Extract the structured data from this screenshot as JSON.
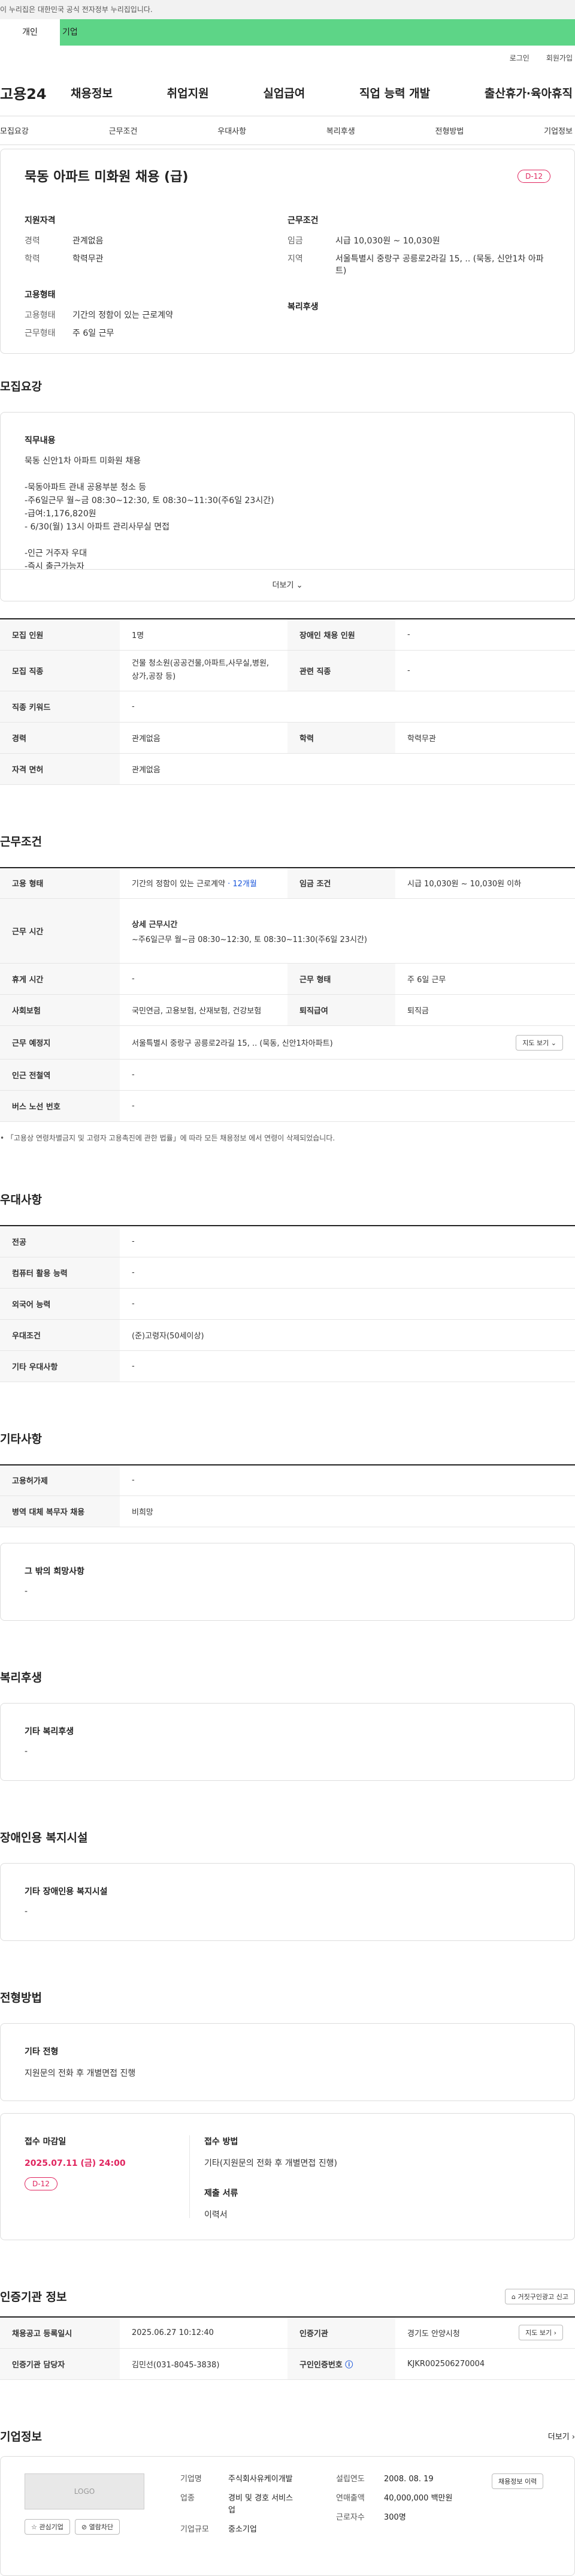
{
  "banner": {
    "text": "이 누리집은 대한민국 공식 전자정부 누리집입니다."
  },
  "user_tabs": [
    "개인",
    "기업"
  ],
  "util": [
    "로그인",
    "회원가입"
  ],
  "logo": "고용24",
  "gnb": [
    "채용정보",
    "취업지원",
    "실업급여",
    "직업 능력 개발",
    "출산휴가·육아휴직"
  ],
  "anchor_tabs": [
    "모집요강",
    "근무조건",
    "우대사항",
    "복리후생",
    "전형방법",
    "기업정보"
  ],
  "summary": {
    "title": "묵동 아파트 미화원 채용 (급)",
    "dday": "D-12",
    "qual_heading": "지원자격",
    "qual": [
      {
        "k": "경력",
        "v": "관계없음"
      },
      {
        "k": "학력",
        "v": "학력무관"
      }
    ],
    "emp_heading": "고용형태",
    "emp": [
      {
        "k": "고용형태",
        "v": "기간의 정함이 있는 근로계약"
      },
      {
        "k": "근무형태",
        "v": "주 6일 근무"
      }
    ],
    "work_heading": "근무조건",
    "work": [
      {
        "k": "임금",
        "v": "시급 10,030원 ~ 10,030원"
      },
      {
        "k": "지역",
        "v": "서울특별시 중랑구 공릉로2라길 15, .. (묵동, 신안1차 아파트)"
      }
    ],
    "welfare_heading": "복리후생"
  },
  "recruit": {
    "title": "모집요강",
    "job_heading": "직무내용",
    "lines": [
      "묵동 신안1차 아파트  미화원  채용",
      "",
      "-묵동아파트 관내 공용부분 청소 등",
      "-주6일근무 월~금 08:30~12:30, 토 08:30~11:30(주6일 23시간)",
      "-급여:1,176,820원",
      "- 6/30(월) 13시 아파트 관리사무실 면접",
      "",
      "-인근 거주자  우대",
      "-즉시 출근가능자"
    ],
    "more": "더보기",
    "table": [
      {
        "k1": "모집 인원",
        "v1": "1명",
        "k2": "장애인 채용 인원",
        "v2": "-"
      },
      {
        "k1": "모집 직종",
        "v1": "건물 청소원(공공건물,아파트,사무실,병원,상가,공장 등)",
        "k2": "관련 직종",
        "v2": "-"
      },
      {
        "k1": "직종 키워드",
        "v1": "-"
      },
      {
        "k1": "경력",
        "v1": "관계없음",
        "k2": "학력",
        "v2": "학력무관"
      },
      {
        "k1": "자격 면허",
        "v1": "관계없음"
      }
    ]
  },
  "conditions": {
    "title": "근무조건",
    "emp_type_label": "고용 형태",
    "emp_type": "기간의 정함이 있는 근로계약",
    "emp_term": "· 12개월",
    "wage_label": "임금 조건",
    "wage": "시급 10,030원 ~ 10,030원 이하",
    "hours_label": "근무 시간",
    "hours_title": "상세 근무시간",
    "hours": "~주6일근무 월~금 08:30~12:30, 토 08:30~11:30(주6일 23시간)",
    "rest_label": "휴게 시간",
    "rest": "-",
    "work_type_label": "근무 형태",
    "work_type": "주 6일 근무",
    "insurance_label": "사회보험",
    "insurance": "국민연금, 고용보험, 산재보험, 건강보험",
    "retire_label": "퇴직급여",
    "retire": "퇴직금",
    "place_label": "근무 예정지",
    "place": "서울특별시 중랑구 공릉로2라길 15, .. (묵동, 신안1차아파트)",
    "map_btn": "지도 보기",
    "subway_label": "인근 전철역",
    "subway": "-",
    "bus_label": "버스 노선 번호",
    "bus": "-",
    "note": "• 「고용상 연령차별금지 및 고령자 고용촉진에 관한 법률」에 따라 모든 채용정보 에서 연령이 삭제되었습니다."
  },
  "preference": {
    "title": "우대사항",
    "rows": [
      {
        "k": "전공",
        "v": "-"
      },
      {
        "k": "컴퓨터 활용 능력",
        "v": "-"
      },
      {
        "k": "외국어 능력",
        "v": "-"
      },
      {
        "k": "우대조건",
        "v": "(준)고령자(50세이상)"
      },
      {
        "k": "기타 우대사항",
        "v": "-"
      }
    ]
  },
  "etc": {
    "title": "기타사항",
    "rows": [
      {
        "k": "고용허가제",
        "v": "-"
      },
      {
        "k": "병역 대체 복무자 채용",
        "v": "비희망"
      }
    ],
    "other_heading": "그 밖의 희망사항",
    "other": "-"
  },
  "welfare": {
    "title": "복리후생",
    "heading": "기타 복리후생",
    "value": "-"
  },
  "disability": {
    "title": "장애인용 복지시설",
    "heading": "기타 장애인용 복지시설",
    "value": "-"
  },
  "selection": {
    "title": "전형방법",
    "heading": "기타 전형",
    "value": "지원문의 전화 후 개별면접 진행",
    "deadline_label": "접수 마감일",
    "deadline": "2025.07.11 (금) 24:00",
    "dday": "D-12",
    "method_label": "접수 방법",
    "method": "기타(지원문의 전화 후 개별면접 진행)",
    "docs_label": "제출 서류",
    "docs": "이력서"
  },
  "cert": {
    "title": "인증기관 정보",
    "report_btn": "거짓구인광고 신고",
    "reg_label": "채용공고 등록일시",
    "reg": "2025.06.27 10:12:40",
    "agency_label": "인증기관",
    "agency": "경기도 안양시청",
    "map_btn": "지도 보기",
    "manager_label": "인증기관 담당자",
    "manager": "김민선(031-8045-3838)",
    "cert_no_label": "구인인증번호",
    "cert_no": "KJKR002506270004"
  },
  "company": {
    "title": "기업정보",
    "more": "더보기",
    "logo": "LOGO",
    "fav_btn": "관심기업",
    "block_btn": "열람차단",
    "name_label": "기업명",
    "name": "주식회사유케이개발",
    "industry_label": "업종",
    "industry": "경비 및 경호 서비스업",
    "size_label": "기업규모",
    "size": "중소기업",
    "founded_label": "설립연도",
    "founded": "2008. 08. 19",
    "revenue_label": "연매출액",
    "revenue": "40,000,000 백만원",
    "employees_label": "근로자수",
    "employees": "300명",
    "jobs_btn": "채용정보 이력"
  }
}
